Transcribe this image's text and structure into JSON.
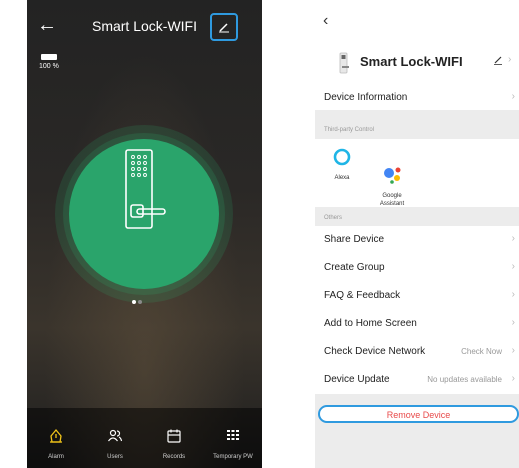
{
  "left": {
    "title": "Smart Lock-WIFI",
    "battery_text": "100 %",
    "nav": [
      {
        "label": "Alarm",
        "icon": "alarm-icon"
      },
      {
        "label": "Users",
        "icon": "users-icon"
      },
      {
        "label": "Records",
        "icon": "calendar-icon"
      },
      {
        "label": "Temporary PW",
        "icon": "keypad-icon"
      }
    ]
  },
  "right": {
    "device_name": "Smart Lock-WIFI",
    "device_info": "Device Information",
    "third_party_header": "Third-party Control",
    "integrations": [
      {
        "label": "Alexa",
        "icon": "alexa-icon"
      },
      {
        "label": "Google\nAssistant",
        "icon": "google-assistant-icon"
      }
    ],
    "others_header": "Others",
    "items": [
      {
        "label": "Share Device",
        "value": ""
      },
      {
        "label": "Create Group",
        "value": ""
      },
      {
        "label": "FAQ & Feedback",
        "value": ""
      },
      {
        "label": "Add to Home Screen",
        "value": ""
      },
      {
        "label": "Check Device Network",
        "value": "Check Now"
      },
      {
        "label": "Device Update",
        "value": "No updates available"
      }
    ],
    "remove": "Remove Device"
  },
  "colors": {
    "accent_green": "#2aa46b",
    "highlight_blue": "#2f9adf",
    "danger_red": "#e84a4a"
  }
}
